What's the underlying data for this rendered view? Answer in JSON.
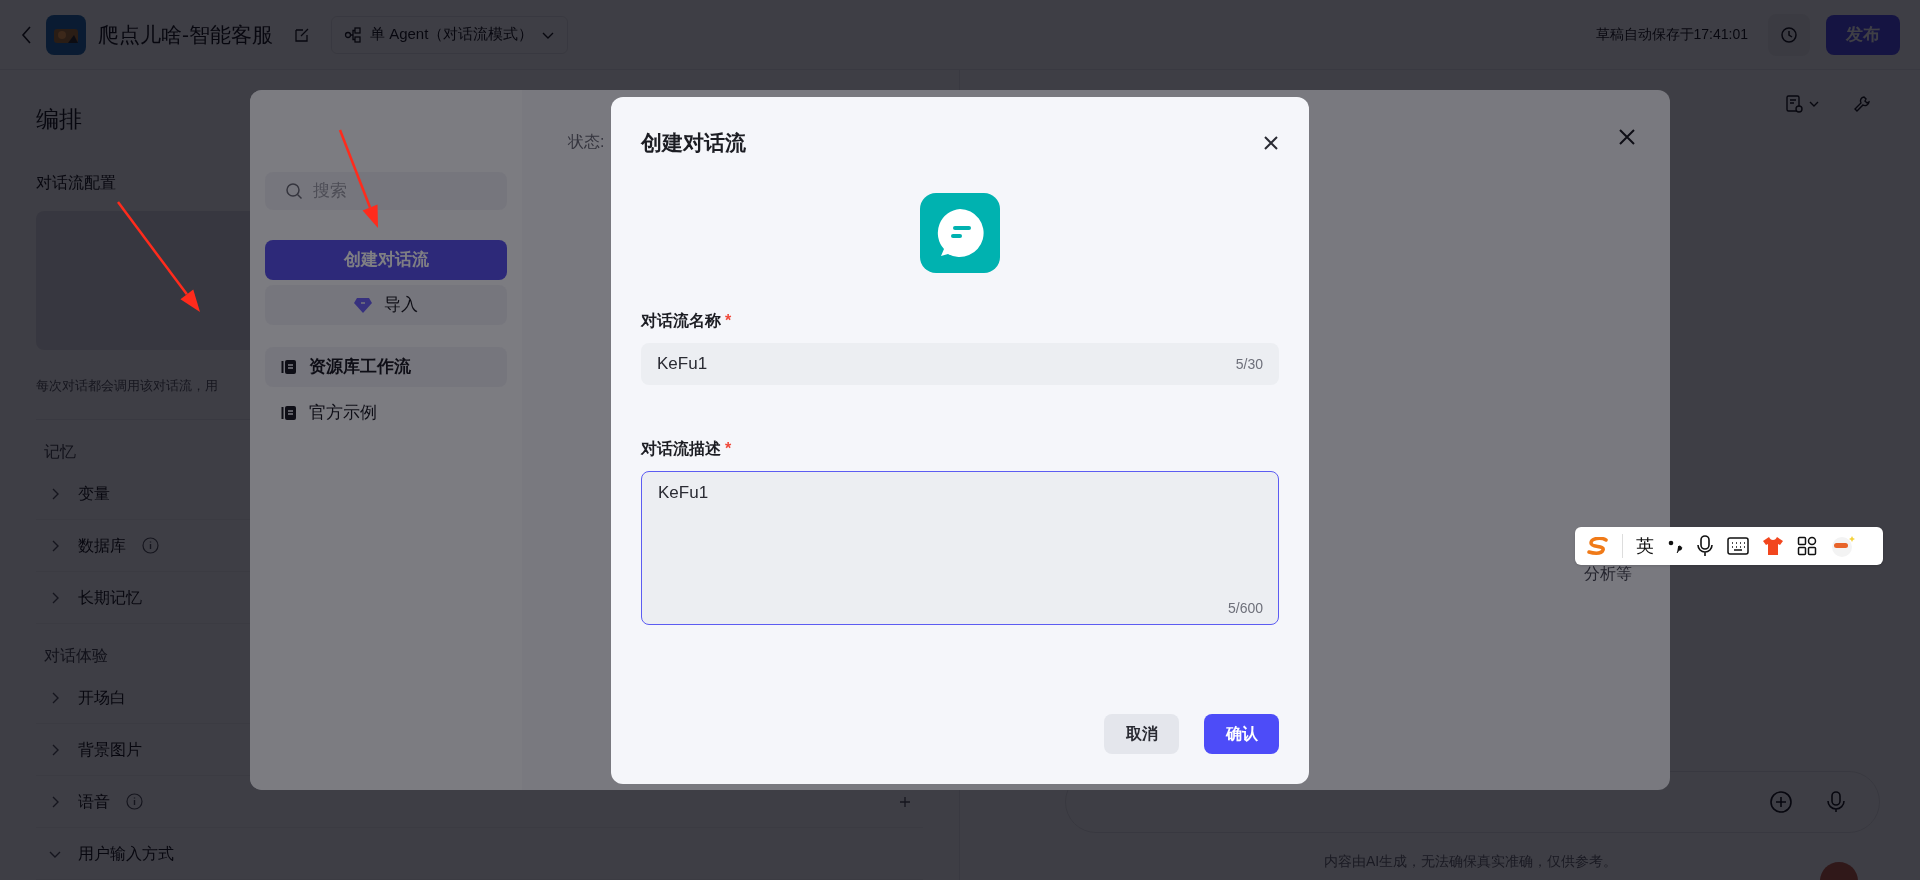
{
  "header": {
    "title": "爬点儿啥-智能客服",
    "mode": "单 Agent（对话流模式）",
    "autosave": "草稿自动保存于17:41:01",
    "publish": "发布"
  },
  "left_panel": {
    "title": "编排",
    "section": "对话流配置",
    "hint": "每次对话都会调用该对话流，用",
    "groups": [
      {
        "label": "记忆",
        "items": [
          {
            "label": "变量",
            "expanded": false,
            "info": false,
            "add": false
          },
          {
            "label": "数据库",
            "expanded": false,
            "info": true,
            "add": false
          },
          {
            "label": "长期记忆",
            "expanded": false,
            "info": false,
            "add": false
          }
        ]
      },
      {
        "label": "对话体验",
        "items": [
          {
            "label": "开场白",
            "expanded": false,
            "info": false,
            "add": false
          },
          {
            "label": "背景图片",
            "expanded": false,
            "info": false,
            "add": false
          },
          {
            "label": "语音",
            "expanded": false,
            "info": true,
            "add": true
          },
          {
            "label": "用户输入方式",
            "expanded": true,
            "info": false,
            "add": false
          }
        ]
      }
    ]
  },
  "workflow_picker": {
    "search": {
      "placeholder": "搜索"
    },
    "create": "创建对话流",
    "import": "导入",
    "categories": [
      {
        "label": "资源库工作流",
        "selected": true
      },
      {
        "label": "官方示例",
        "selected": false
      }
    ],
    "status_label": "状态:",
    "text_fragment": "分析等"
  },
  "dialog": {
    "title": "创建对话流",
    "name_label": "对话流名称",
    "name_marker": "*",
    "name_value": "KeFu1",
    "name_count": "5/30",
    "desc_label": "对话流描述",
    "desc_marker": "*",
    "desc_value": "KeFu1",
    "desc_count": "5/600",
    "cancel": "取消",
    "confirm": "确认"
  },
  "chat": {
    "disclaimer": "内容由AI生成，无法确保真实准确，仅供参考。"
  },
  "ime_toolbar": {
    "mode": "英"
  }
}
